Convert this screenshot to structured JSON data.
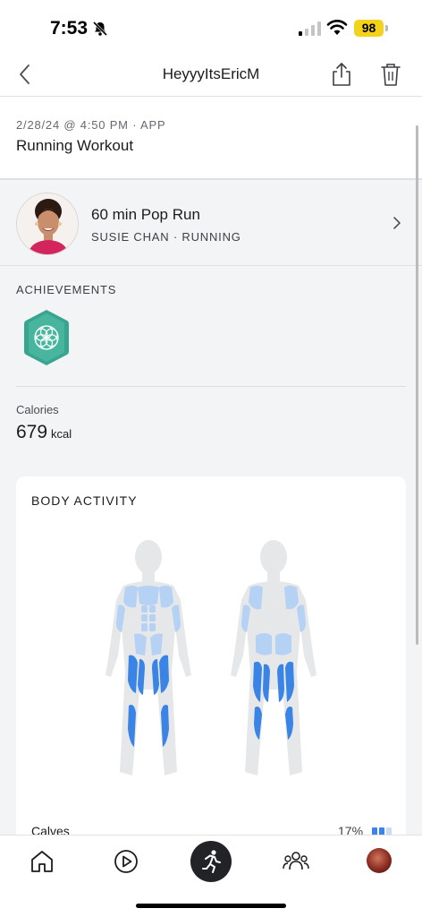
{
  "status": {
    "time": "7:53",
    "battery": "98"
  },
  "nav": {
    "title": "HeyyyItsEricM"
  },
  "workout": {
    "meta": "2/28/24 @ 4:50 PM  ·  APP",
    "title": "Running Workout"
  },
  "class": {
    "name": "60 min Pop Run",
    "subtitle": "SUSIE CHAN  ·  RUNNING"
  },
  "achievements": {
    "label": "ACHIEVEMENTS"
  },
  "calories": {
    "label": "Calories",
    "value": "679",
    "unit": "kcal"
  },
  "body_activity": {
    "title": "BODY ACTIVITY",
    "muscles": [
      {
        "name": "Calves",
        "percent": "17%"
      }
    ]
  },
  "colors": {
    "accent": "#3a84e6",
    "badge": "#3aa58f",
    "battery": "#f4d21b"
  },
  "tabs": [
    "home-icon",
    "play-icon",
    "run-icon",
    "community-icon",
    "profile-avatar"
  ]
}
